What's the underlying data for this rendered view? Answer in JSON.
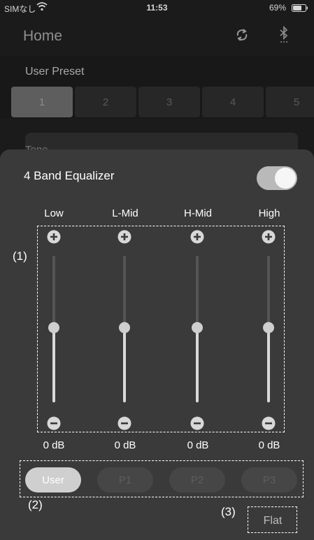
{
  "status_bar": {
    "carrier": "SIMなし",
    "time": "11:53",
    "battery": "69%",
    "battery_level": 0.69
  },
  "nav": {
    "title": "Home",
    "sync_icon": "sync-icon",
    "bluetooth_icon": "bluetooth-icon"
  },
  "preset": {
    "label": "User Preset",
    "tabs": [
      {
        "label": "1",
        "selected": true
      },
      {
        "label": "2",
        "selected": false
      },
      {
        "label": "3",
        "selected": false
      },
      {
        "label": "4",
        "selected": false
      },
      {
        "label": "5",
        "selected": false
      }
    ]
  },
  "tone": {
    "label": "Tone"
  },
  "equalizer": {
    "title": "4 Band Equalizer",
    "enabled": true,
    "bands": [
      {
        "name": "Low",
        "value": "0 dB"
      },
      {
        "name": "L-Mid",
        "value": "0 dB"
      },
      {
        "name": "H-Mid",
        "value": "0 dB"
      },
      {
        "name": "High",
        "value": "0 dB"
      }
    ],
    "presets": [
      {
        "label": "User",
        "selected": true
      },
      {
        "label": "P1",
        "selected": false
      },
      {
        "label": "P2",
        "selected": false
      },
      {
        "label": "P3",
        "selected": false
      }
    ],
    "flat_label": "Flat"
  },
  "annotations": {
    "a1": "(1)",
    "a2": "(2)",
    "a3": "(3)"
  },
  "colors": {
    "background": "#1b1b1b",
    "sheet": "#3a3a3a",
    "toggle_on": "#b9b9b9",
    "text": "#ffffff"
  }
}
